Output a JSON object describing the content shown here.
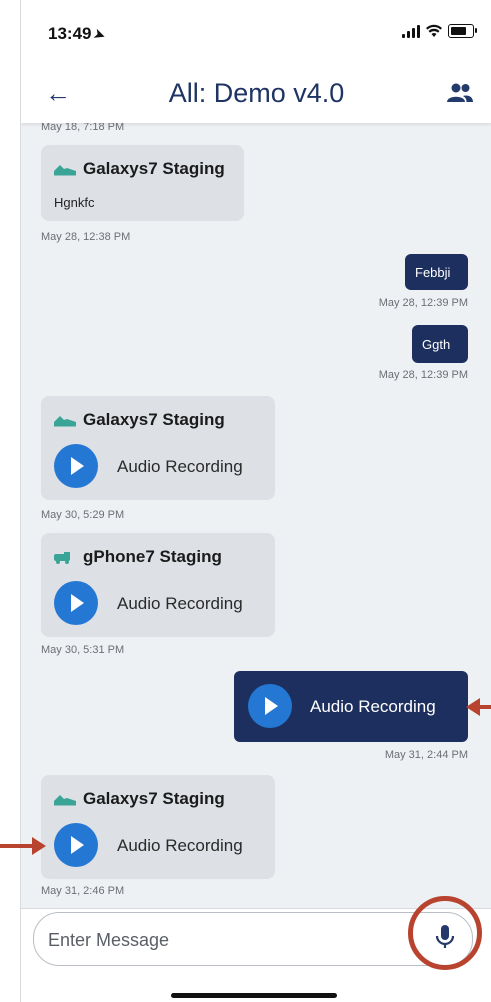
{
  "status": {
    "time": "13:49"
  },
  "header": {
    "title": "All: Demo v4.0"
  },
  "messages": {
    "top_ts": "May 18, 7:18 PM",
    "m1": {
      "sender": "Galaxys7 Staging",
      "text": "Hgnkfc",
      "ts": "May 28, 12:38 PM"
    },
    "m2": {
      "text": "Febbji",
      "ts": "May 28, 12:39 PM"
    },
    "m3": {
      "text": "Ggth",
      "ts": "May 28, 12:39 PM"
    },
    "m4": {
      "sender": "Galaxys7 Staging",
      "audio": "Audio Recording",
      "ts": "May 30, 5:29 PM"
    },
    "m5": {
      "sender": "gPhone7 Staging",
      "audio": "Audio Recording",
      "ts": "May 30, 5:31 PM"
    },
    "m6": {
      "audio": "Audio Recording",
      "ts": "May 31, 2:44 PM"
    },
    "m7": {
      "sender": "Galaxys7 Staging",
      "audio": "Audio Recording",
      "ts": "May 31, 2:46 PM"
    }
  },
  "input": {
    "placeholder": "Enter Message"
  },
  "colors": {
    "accent": "#1d2f5e",
    "play": "#2478d4",
    "annotation": "#b8432e",
    "sender_icon": "#3aa597"
  },
  "icons": [
    "location-arrow-icon",
    "signal-icon",
    "wifi-icon",
    "battery-icon",
    "back-arrow-icon",
    "group-icon",
    "car-icon",
    "play-icon",
    "microphone-icon"
  ]
}
